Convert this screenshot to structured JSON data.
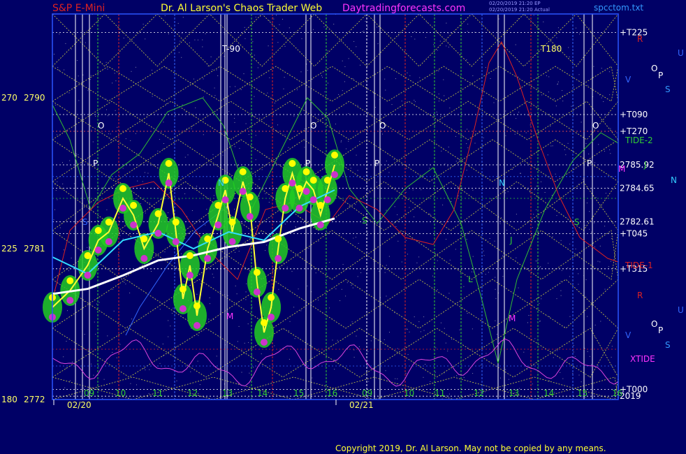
{
  "header": {
    "symbol": "S&P E-Mini",
    "site_title": "Dr. Al Larson's Chaos Trader Web",
    "site_url": "Daytradingforecasts.com",
    "stamp1": "02/20/2019 21:20 EP",
    "stamp2": "02/20/2019 21:20 Actual",
    "file": "spcctom.txt"
  },
  "copyright": "Copyright 2019, Dr. Al Larson. May not be copied by any means.",
  "colors": {
    "background": "#000066",
    "frame": "#2b55ff",
    "ema_cyan": "#33ddff",
    "ema_white": "#ffffff",
    "price_yellow": "#ffff33",
    "highlow_magenta": "#cc33cc",
    "channel_green": "#22cc22",
    "flux_red": "#dd2222",
    "flux_green": "#33bb33",
    "xtide_magenta": "#dd44dd",
    "grid_yellow": "#cccc44"
  },
  "chart_data": {
    "type": "line",
    "title": "S&P E-Mini",
    "xlabel": "",
    "ylabel": "",
    "ylim": [
      2772,
      2795
    ],
    "y_left_labels": [
      {
        "angle": "270",
        "price": "2790",
        "value": 2790
      },
      {
        "angle": "225",
        "price": "2781",
        "value": 2781
      },
      {
        "angle": "180",
        "price": "2772",
        "value": 2772
      }
    ],
    "date_labels": [
      "02/20",
      "02/21"
    ],
    "hour_labels": [
      "09",
      "10",
      "11",
      "12",
      "13",
      "14",
      "15",
      "16",
      "09",
      "10",
      "11",
      "12",
      "13",
      "14",
      "15",
      "16"
    ],
    "right_labels": [
      {
        "text": "T225",
        "value": 2793.9
      },
      {
        "text": "T090",
        "value": 2789.0
      },
      {
        "text": "T270",
        "value": 2788.0
      },
      {
        "text": "2785.92",
        "value": 2786.0
      },
      {
        "text": "2784.65",
        "value": 2784.6
      },
      {
        "text": "2782.61",
        "value": 2782.6
      },
      {
        "text": "T045",
        "value": 2781.9
      },
      {
        "text": "T315",
        "value": 2779.8
      },
      {
        "text": "T000",
        "value": 2772.6
      },
      {
        "text": "2019",
        "value": 2772.2
      }
    ],
    "side_labels": [
      "R",
      "U",
      "O",
      "P",
      "S",
      "V",
      "TIDE-2",
      "J",
      "M",
      "N",
      "TIDE-1",
      "XTIDE"
    ],
    "chart_markers": [
      "O",
      "P",
      "N",
      "S",
      "L",
      "J",
      "M",
      "T-90",
      "T180"
    ],
    "series": [
      {
        "name": "",
        "role": "price",
        "x": [
          0.0,
          0.5,
          1.0,
          1.3,
          1.6,
          2.0,
          2.3,
          2.6,
          3.0,
          3.3,
          3.5,
          3.7,
          3.9,
          4.1,
          4.4,
          4.7,
          4.9,
          5.1,
          5.4,
          5.6,
          5.8,
          6.0,
          6.2,
          6.4,
          6.6,
          6.8,
          7.0,
          7.2,
          7.4,
          7.6,
          7.8,
          8.0
        ],
        "y": [
          2777.5,
          2778.5,
          2780.0,
          2781.5,
          2782.0,
          2784.0,
          2783.0,
          2781.0,
          2782.5,
          2785.5,
          2782.0,
          2778.0,
          2780.0,
          2777.0,
          2781.0,
          2783.0,
          2784.5,
          2782.0,
          2785.0,
          2783.5,
          2779.0,
          2776.0,
          2777.5,
          2781.0,
          2784.0,
          2785.5,
          2784.0,
          2785.0,
          2784.5,
          2783.0,
          2784.5,
          2786.0
        ]
      },
      {
        "name": "",
        "role": "ema_fast",
        "x": [
          0.0,
          1.0,
          2.0,
          3.0,
          4.0,
          5.0,
          6.0,
          7.0,
          8.0
        ],
        "y": [
          2780.5,
          2779.5,
          2781.5,
          2782.0,
          2781.0,
          2782.0,
          2781.5,
          2783.5,
          2784.5
        ]
      },
      {
        "name": "",
        "role": "ema_slow",
        "x": [
          0.0,
          1.0,
          2.0,
          3.0,
          4.0,
          5.0,
          6.0,
          7.0,
          8.0
        ],
        "y": [
          2778.3,
          2778.6,
          2779.4,
          2780.3,
          2780.6,
          2781.1,
          2781.4,
          2782.2,
          2782.8
        ]
      }
    ],
    "grid": true,
    "legend": "none"
  }
}
